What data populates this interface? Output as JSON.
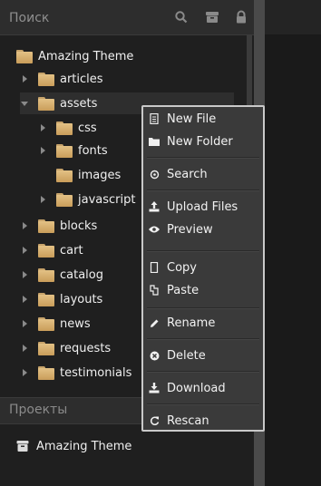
{
  "search": {
    "placeholder": "Поиск"
  },
  "tree": {
    "root": "Amazing Theme",
    "items": [
      {
        "label": "articles"
      },
      {
        "label": "assets"
      },
      {
        "label": "css"
      },
      {
        "label": "fonts"
      },
      {
        "label": "images"
      },
      {
        "label": "javascript"
      },
      {
        "label": "blocks"
      },
      {
        "label": "cart"
      },
      {
        "label": "catalog"
      },
      {
        "label": "layouts"
      },
      {
        "label": "news"
      },
      {
        "label": "requests"
      },
      {
        "label": "testimonials"
      }
    ]
  },
  "projects": {
    "title": "Проекты",
    "items": [
      {
        "label": "Amazing Theme"
      }
    ]
  },
  "context_menu": {
    "items": [
      {
        "label": "New File"
      },
      {
        "label": "New Folder"
      },
      {
        "label": "Search"
      },
      {
        "label": "Upload Files"
      },
      {
        "label": "Preview"
      },
      {
        "label": "Copy"
      },
      {
        "label": "Paste"
      },
      {
        "label": "Rename"
      },
      {
        "label": "Delete"
      },
      {
        "label": "Download"
      },
      {
        "label": "Rescan"
      }
    ]
  },
  "colors": {
    "folder": "#d9b476",
    "background": "#1f1f1f",
    "menu_bg": "#3a3a3a",
    "menu_border": "#c9c9c9"
  }
}
